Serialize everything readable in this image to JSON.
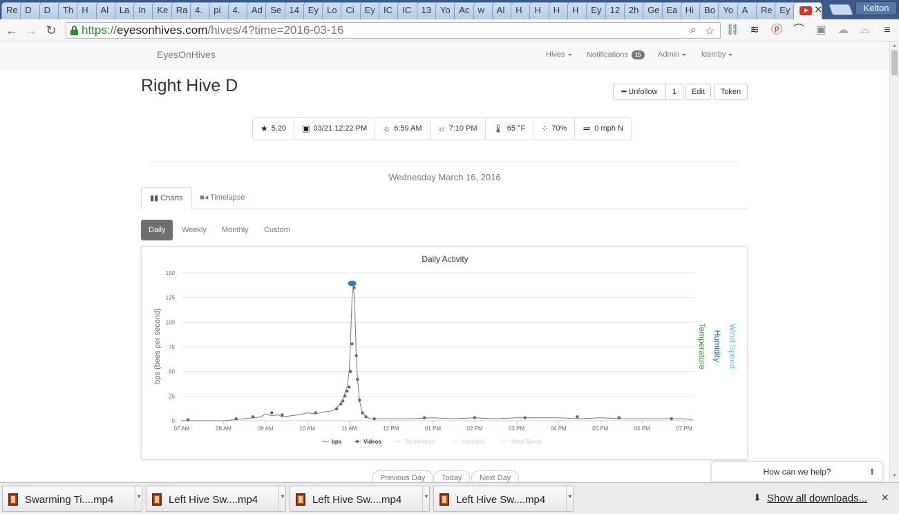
{
  "browser": {
    "tabs": [
      "Re",
      "D",
      "D",
      "Th",
      "H",
      "Al",
      "La",
      "In",
      "Ke",
      "Ra",
      "4.",
      "pi",
      "4.",
      "Ad",
      "Se",
      "14",
      "Ey",
      "Lo",
      "Ci",
      "Ey",
      "IC",
      "IC",
      "13",
      "Yo",
      "Ac",
      "w",
      "Al",
      "H",
      "H",
      "H",
      "H",
      "Ey",
      "12",
      "2h",
      "Ge",
      "Ea",
      "Hi",
      "Bo",
      "Yo",
      "A",
      "Re",
      "Ey"
    ],
    "profile_name": "Kelton",
    "url": {
      "scheme": "https://",
      "host": "eyesonhives.com",
      "path": "/hives/4?time=2016-03-16"
    }
  },
  "navbar": {
    "brand": "EyesOnHives",
    "hives_label": "Hives",
    "notifications_label": "Notifications",
    "notifications_count": "15",
    "admin_label": "Admin",
    "user_label": "ktemby"
  },
  "hive": {
    "title": "Right Hive D",
    "unfollow_label": "Unfollow",
    "follow_count": "1",
    "edit_label": "Edit",
    "token_label": "Token"
  },
  "stats": {
    "rating": "5.20",
    "last_update": "03/21 12:22 PM",
    "sunrise": "6:59 AM",
    "sunset": "7:10 PM",
    "temperature": "65 °F",
    "humidity": "70%",
    "wind": "0 mph N"
  },
  "date_heading": "Wednesday March 16, 2016",
  "view_tabs": {
    "charts": "Charts",
    "timelapse": "Timelapse"
  },
  "periods": {
    "daily": "Daily",
    "weekly": "Weekly",
    "monthly": "Monthly",
    "custom": "Custom"
  },
  "day_nav": {
    "previous": "Previous Day",
    "today": "Today",
    "next": "Next Day"
  },
  "help_label": "How can we help?",
  "downloads": {
    "items": [
      "Swarming Ti....mp4",
      "Left Hive Sw....mp4",
      "Left Hive Sw....mp4",
      "Left Hive Sw....mp4"
    ],
    "show_all": "Show all downloads..."
  },
  "chart_data": {
    "type": "line",
    "title": "Daily Activity",
    "ylabel": "bps (bees per second)",
    "right_axis_labels": [
      "Temperature",
      "Humidity",
      "Wind Speed"
    ],
    "ylim": [
      0,
      150
    ],
    "yticks": [
      0,
      25,
      50,
      75,
      100,
      125,
      150
    ],
    "xlim": [
      7,
      19.25
    ],
    "xticks": [
      {
        "x": 7,
        "label": "07 AM"
      },
      {
        "x": 8,
        "label": "08 AM"
      },
      {
        "x": 9,
        "label": "09 AM"
      },
      {
        "x": 10,
        "label": "10 AM"
      },
      {
        "x": 11,
        "label": "11 AM"
      },
      {
        "x": 12,
        "label": "12 PM"
      },
      {
        "x": 13,
        "label": "01 PM"
      },
      {
        "x": 14,
        "label": "02 PM"
      },
      {
        "x": 15,
        "label": "03 PM"
      },
      {
        "x": 16,
        "label": "04 PM"
      },
      {
        "x": 17,
        "label": "05 PM"
      },
      {
        "x": 18,
        "label": "06 PM"
      },
      {
        "x": 19,
        "label": "07 PM"
      }
    ],
    "legend": [
      "bps",
      "Videos",
      "Temperature",
      "Humidity",
      "Wind Speed"
    ],
    "legend_position": "bottom",
    "colors": {
      "bps": "#777777",
      "videos": "#666666",
      "temperature": "#3a9a3a",
      "humidity": "#2a6fa8",
      "wind": "#5bc0de",
      "marker": "#337ab7"
    },
    "series": [
      {
        "name": "bps",
        "x": [
          7.0,
          7.5,
          8.0,
          8.25,
          8.5,
          8.7,
          8.9,
          9.0,
          9.15,
          9.3,
          9.4,
          9.6,
          9.8,
          10.0,
          10.2,
          10.4,
          10.6,
          10.7,
          10.8,
          10.85,
          10.9,
          10.95,
          11.0,
          11.03,
          11.07,
          11.1,
          11.13,
          11.17,
          11.2,
          11.25,
          11.3,
          11.4,
          11.5,
          11.6,
          11.8,
          12.0,
          12.5,
          13.0,
          13.5,
          14.0,
          14.5,
          15.0,
          15.5,
          16.0,
          16.5,
          17.0,
          17.5,
          18.0,
          18.5,
          19.0,
          19.2
        ],
        "y": [
          0,
          0,
          0,
          1,
          2,
          3,
          4,
          7,
          5,
          6,
          4,
          5,
          6,
          8,
          7,
          9,
          10,
          13,
          18,
          22,
          28,
          35,
          50,
          78,
          125,
          138,
          120,
          66,
          42,
          20,
          10,
          4,
          2,
          2,
          2,
          2,
          2,
          3,
          2,
          3,
          2,
          3,
          3,
          3,
          2,
          3,
          2,
          2,
          2,
          2,
          1
        ]
      },
      {
        "name": "Videos",
        "x": [
          7.15,
          8.3,
          8.7,
          9.15,
          9.4,
          10.2,
          10.7,
          10.8,
          10.85,
          10.9,
          10.95,
          11.0,
          11.03,
          11.07,
          11.12,
          11.17,
          11.2,
          11.25,
          11.32,
          11.4,
          11.6,
          12.8,
          14.0,
          15.2,
          16.45,
          17.45,
          18.7
        ],
        "y": [
          1,
          2,
          4,
          8,
          6,
          8,
          12,
          17,
          20,
          25,
          30,
          34,
          50,
          78,
          135,
          66,
          42,
          21,
          8,
          4,
          2,
          3,
          3,
          3,
          4,
          3,
          2
        ]
      }
    ],
    "annotations": [
      {
        "x": 11.07,
        "y": 140,
        "type": "marker"
      }
    ]
  }
}
